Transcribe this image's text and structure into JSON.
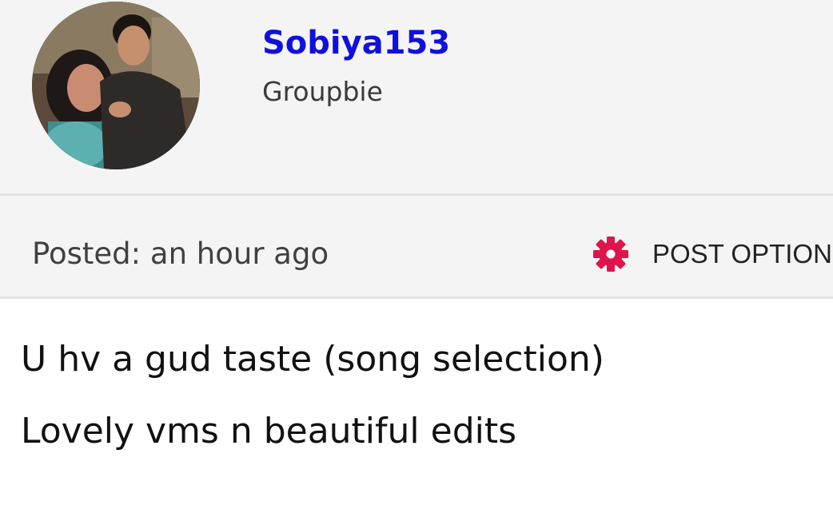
{
  "author": {
    "username": "Sobiya153",
    "rank": "Groupbie",
    "avatar_icon": "user-avatar-photo"
  },
  "meta": {
    "posted": "Posted: an hour ago",
    "post_option_label": "POST OPTION",
    "post_option_icon": "gear-icon"
  },
  "post": {
    "lines": [
      "U hv a gud taste (song selection)",
      "Lovely vms n beautiful edits"
    ]
  },
  "colors": {
    "username": "#1010dd",
    "gear": "#e0144c",
    "panel_bg": "#f4f4f4"
  }
}
